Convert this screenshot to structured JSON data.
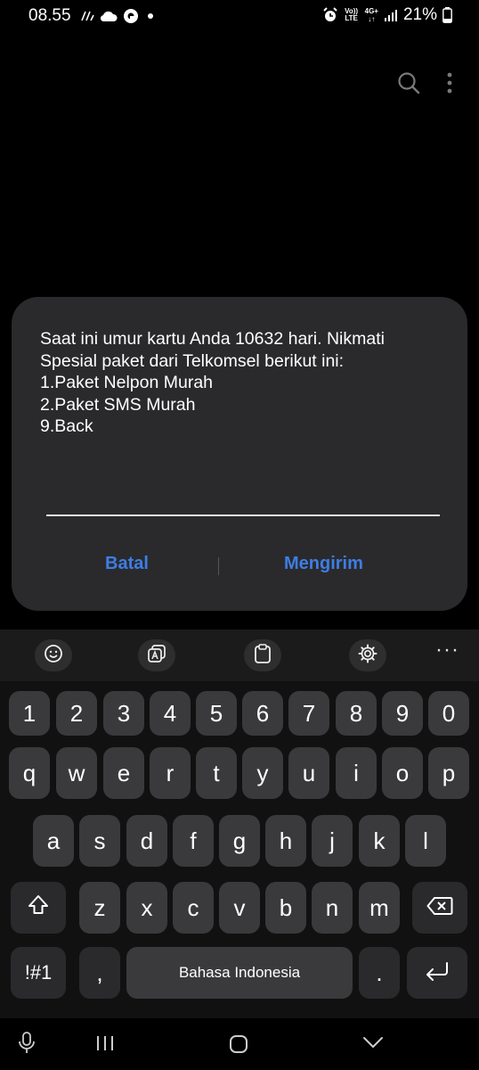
{
  "status_bar": {
    "time": "08.55",
    "battery": "21%",
    "network_volte": "Vo)) LTE",
    "network_4g": "4G+"
  },
  "dialog": {
    "message": "Saat ini umur kartu Anda 10632 hari. Nikmati\nSpesial paket dari Telkomsel berikut ini:\n1.Paket Nelpon Murah\n2.Paket SMS Murah\n9.Back",
    "input_value": "",
    "cancel_label": "Batal",
    "send_label": "Mengirim",
    "accent_color": "#3e7de4"
  },
  "keyboard": {
    "toolbar": [
      "emoji-icon",
      "sticker-translate-icon",
      "clipboard-icon",
      "settings-icon",
      "more-icon"
    ],
    "more_label": "···",
    "row_numbers": [
      "1",
      "2",
      "3",
      "4",
      "5",
      "6",
      "7",
      "8",
      "9",
      "0"
    ],
    "row1": [
      "q",
      "w",
      "e",
      "r",
      "t",
      "y",
      "u",
      "i",
      "o",
      "p"
    ],
    "row2": [
      "a",
      "s",
      "d",
      "f",
      "g",
      "h",
      "j",
      "k",
      "l"
    ],
    "row3": [
      "z",
      "x",
      "c",
      "v",
      "b",
      "n",
      "m"
    ],
    "symbols_label": "!#1",
    "comma_label": ",",
    "space_label": "Bahasa Indonesia",
    "period_label": "."
  }
}
